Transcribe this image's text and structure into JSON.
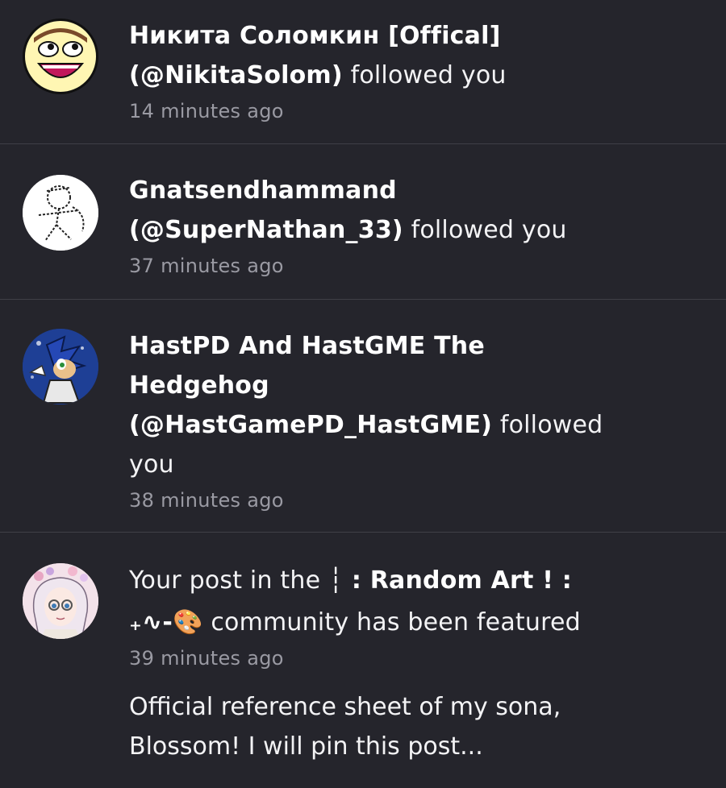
{
  "notifications": [
    {
      "name": "Никита Соломкин [Offical]",
      "handle": "(@NikitaSolom)",
      "action": "followed you",
      "time": "14 minutes ago"
    },
    {
      "name": "Gnatsendhammand",
      "handle": "(@SuperNathan_33)",
      "action": "followed you",
      "time": "37 minutes ago"
    },
    {
      "name": "HastPD And HastGME The Hedgehog",
      "handle": "(@HastGamePD_HastGME)",
      "action": "followed you",
      "time": "38 minutes ago"
    }
  ],
  "featured": {
    "prefix": "Your post in the",
    "community_name": "┆ : Random Art ! :",
    "community_suffix": "₊∿-🎨",
    "suffix": "community has been featured",
    "time": "39 minutes ago",
    "excerpt": "Official reference sheet of my sona, Blossom! I will pin this post..."
  }
}
